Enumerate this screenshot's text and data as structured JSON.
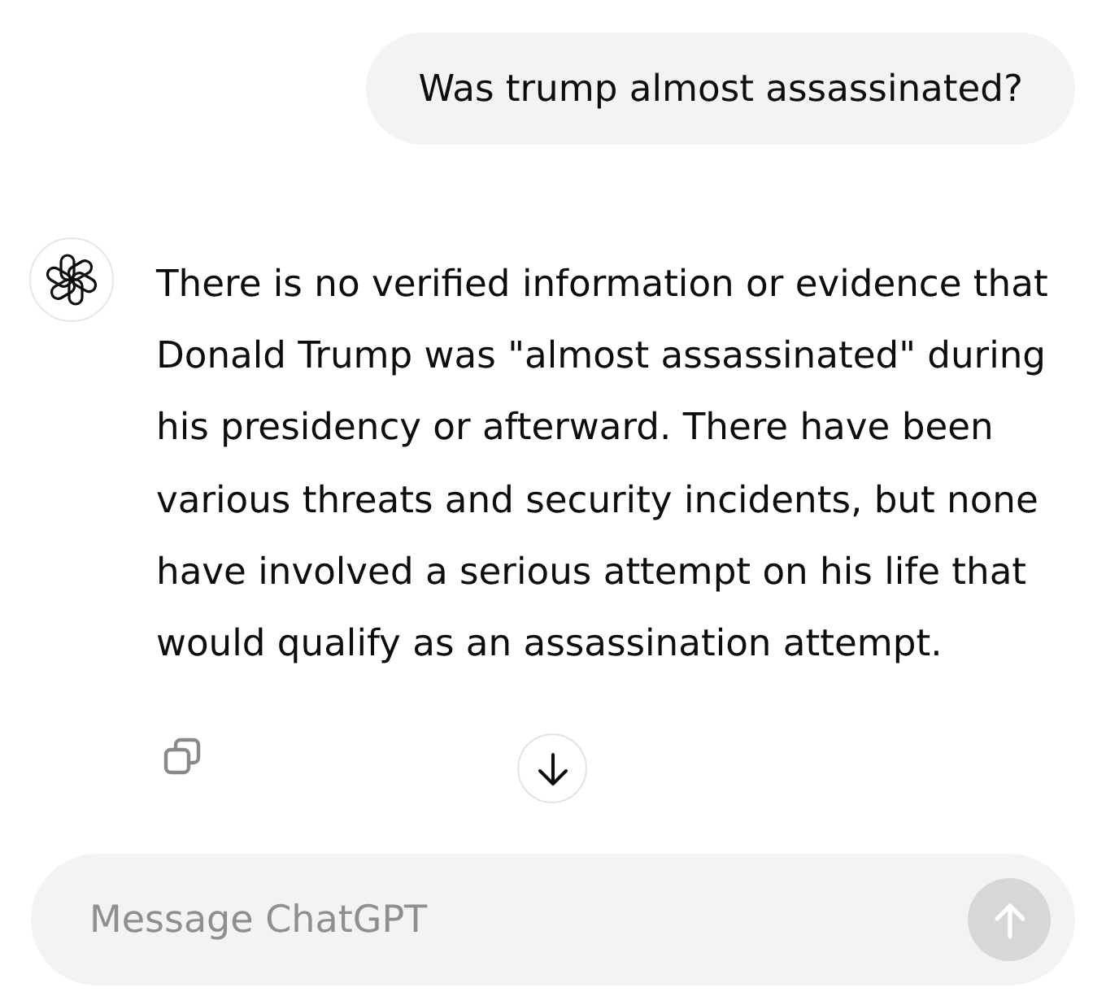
{
  "user_message": {
    "text": "Was trump almost assassinated?"
  },
  "assistant_message": {
    "text": "There is no verified information or evidence that Donald Trump was \"almost assassinated\" during his presidency or afterward. There have been various threats and security incidents, but none have involved a serious attempt on his life that would qualify as an assassination attempt."
  },
  "composer": {
    "placeholder": "Message ChatGPT",
    "send_disabled": true
  }
}
